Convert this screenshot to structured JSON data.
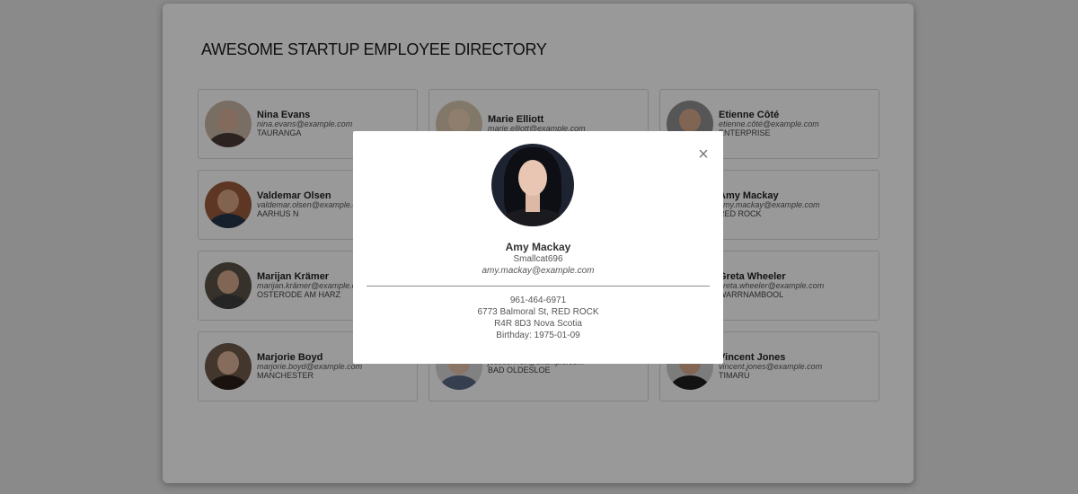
{
  "page": {
    "title": "AWESOME STARTUP EMPLOYEE DIRECTORY"
  },
  "employees": [
    {
      "name": "Nina Evans",
      "email": "nina.evans@example.com",
      "city": "TAURANGA"
    },
    {
      "name": "Marie Elliott",
      "email": "marie.elliott@example.com",
      "city": ""
    },
    {
      "name": "Etienne Côté",
      "email": "etienne.côté@example.com",
      "city": "ENTERPRISE"
    },
    {
      "name": "Valdemar Olsen",
      "email": "valdemar.olsen@example.com",
      "city": "AARHUS N"
    },
    {
      "name": "",
      "email": "",
      "city": ""
    },
    {
      "name": "Amy Mackay",
      "email": "amy.mackay@example.com",
      "city": "RED ROCK"
    },
    {
      "name": "Marijan Krämer",
      "email": "marijan.krämer@example.com",
      "city": "OSTERODE AM HARZ"
    },
    {
      "name": "",
      "email": "",
      "city": ""
    },
    {
      "name": "Greta Wheeler",
      "email": "greta.wheeler@example.com",
      "city": "WARRNAMBOOL"
    },
    {
      "name": "Marjorie Boyd",
      "email": "marjorie.boyd@example.com",
      "city": "MANCHESTER"
    },
    {
      "name": "",
      "email": "jost.schnell@example.com",
      "city": "BAD OLDESLOE"
    },
    {
      "name": "Vincent Jones",
      "email": "vincent.jones@example.com",
      "city": "TIMARU"
    }
  ],
  "modal": {
    "close_label": "×",
    "name": "Amy Mackay",
    "username": "Smallcat696",
    "email": "amy.mackay@example.com",
    "phone": "961-464-6971",
    "address_line1": "6773 Balmoral St, RED ROCK",
    "address_line2": "R4R 8D3 Nova Scotia",
    "birthday": "Birthday: 1975-01-09"
  }
}
